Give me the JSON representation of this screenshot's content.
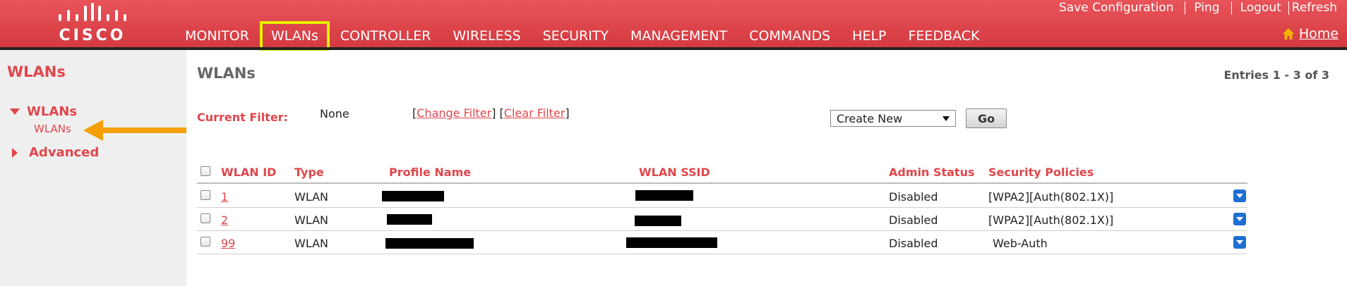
{
  "header": {
    "logo_text": "CISCO",
    "nav": [
      "MONITOR",
      "WLANs",
      "CONTROLLER",
      "WIRELESS",
      "SECURITY",
      "MANAGEMENT",
      "COMMANDS",
      "HELP",
      "FEEDBACK"
    ],
    "active_nav": "WLANs",
    "top_links": [
      "Save Configuration",
      "Ping",
      "Logout",
      "Refresh"
    ],
    "home_label": "Home"
  },
  "sidebar": {
    "title": "WLANs",
    "section_wlans": "WLANs",
    "sub_wlans": "WLANs",
    "section_advanced": "Advanced"
  },
  "main": {
    "title": "WLANs",
    "entries": "Entries 1 - 3 of 3",
    "filter_label": "Current Filter:",
    "filter_value": "None",
    "change_filter": "Change Filter",
    "clear_filter": "Clear Filter",
    "create_select": "Create New",
    "go_label": "Go"
  },
  "table": {
    "columns": [
      "WLAN ID",
      "Type",
      "Profile Name",
      "WLAN SSID",
      "Admin Status",
      "Security Policies"
    ],
    "rows": [
      {
        "id": "1",
        "type": "WLAN",
        "admin_status": "Disabled",
        "security": "[WPA2][Auth(802.1X)]"
      },
      {
        "id": "2",
        "type": "WLAN",
        "admin_status": "Disabled",
        "security": "[WPA2][Auth(802.1X)]"
      },
      {
        "id": "99",
        "type": "WLAN",
        "admin_status": "Disabled",
        "security": "Web-Auth"
      }
    ]
  },
  "colors": {
    "brand_red": "#e0464c",
    "highlight_yellow": "#e6f000",
    "annotation_arrow": "#f3a000",
    "dropdown_blue": "#1f6fd1"
  }
}
